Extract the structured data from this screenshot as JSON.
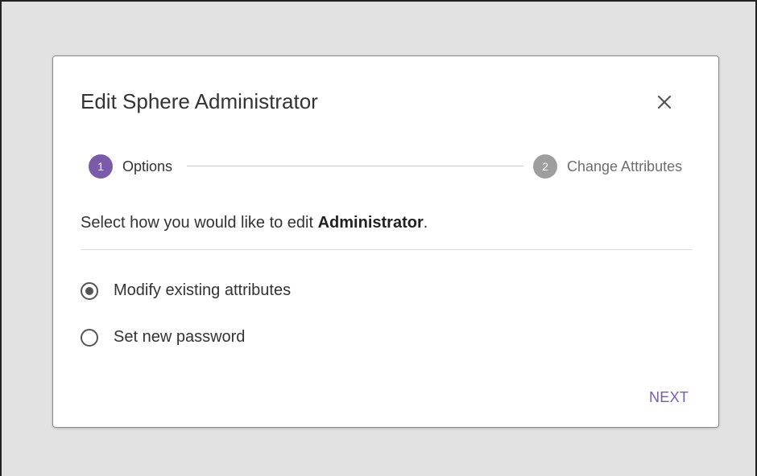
{
  "dialog": {
    "title": "Edit Sphere Administrator",
    "close_icon": "close-icon"
  },
  "stepper": {
    "steps": [
      {
        "number": "1",
        "label": "Options",
        "state": "active"
      },
      {
        "number": "2",
        "label": "Change Attributes",
        "state": "inactive"
      }
    ]
  },
  "prompt": {
    "prefix": "Select how you would like to edit ",
    "target": "Administrator",
    "suffix": "."
  },
  "options": [
    {
      "label": "Modify existing attributes",
      "selected": true
    },
    {
      "label": "Set new password",
      "selected": false
    }
  ],
  "actions": {
    "next_label": "NEXT"
  },
  "colors": {
    "accent": "#7b5ba7",
    "inactive_step": "#9e9e9e",
    "backdrop": "#e2e2e2"
  }
}
